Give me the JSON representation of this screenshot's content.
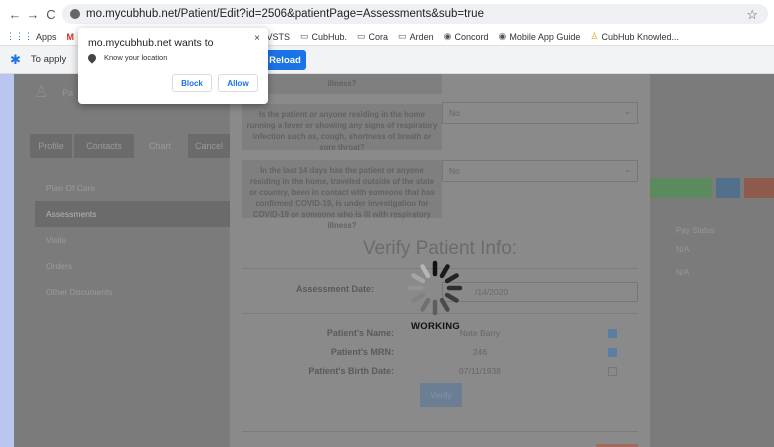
{
  "browser": {
    "url": "mo.mycubhub.net/Patient/Edit?id=2506&patientPage=Assessments&sub=true",
    "bookmarks": [
      "Apps",
      "M",
      "t",
      "VSTS",
      "CubHub.",
      "Cora",
      "Arden",
      "Concord",
      "Mobile App Guide",
      "CubHub Knowled..."
    ]
  },
  "infobar": {
    "text": "To apply",
    "reload_label": "Reload"
  },
  "permission_popup": {
    "title": "mo.mycubhub.net wants to",
    "permission": "Know your location",
    "block_label": "Block",
    "allow_label": "Allow",
    "close": "×"
  },
  "app": {
    "logo_text": "Pa",
    "tabs": [
      "Profile",
      "Contacts",
      "Chart",
      "Cancel"
    ],
    "sidebar": [
      "Plan Of Care",
      "Assessments",
      "Visits",
      "Orders",
      "Other Documents"
    ],
    "right_column_header": "Pay Status",
    "right_column_values": [
      "N/A",
      "N/A"
    ]
  },
  "modal": {
    "partial_text": "illness?",
    "questions": [
      {
        "label": "Is the patient or anyone residing in the home running a fever or showing any signs of respiratory infection such as, cough, shortness of breath or sore throat?",
        "value": "No"
      },
      {
        "label": "In the last 14 days has the patient or anyone residing in the home, traveled outside of the state or country, been in contact with someone that has confirmed COVID-19, is under investigation for COVID-19 or someone who is ill with respiratory illness?",
        "value": "No"
      }
    ],
    "verify_title": "Verify Patient Info:",
    "assessment_date_label": "Assessment Date:",
    "assessment_date_value": "/14/2020",
    "patient_name_label": "Patient's Name:",
    "patient_name_value": "Nate Barry",
    "patient_mrn_label": "Patient's MRN:",
    "patient_mrn_value": "246",
    "patient_dob_label": "Patient's Birth Date:",
    "patient_dob_value": "07/11/1938",
    "checks": {
      "name": true,
      "mrn": true,
      "dob": false
    },
    "verify_button": "Verify"
  },
  "loading": {
    "text": "WORKING"
  }
}
